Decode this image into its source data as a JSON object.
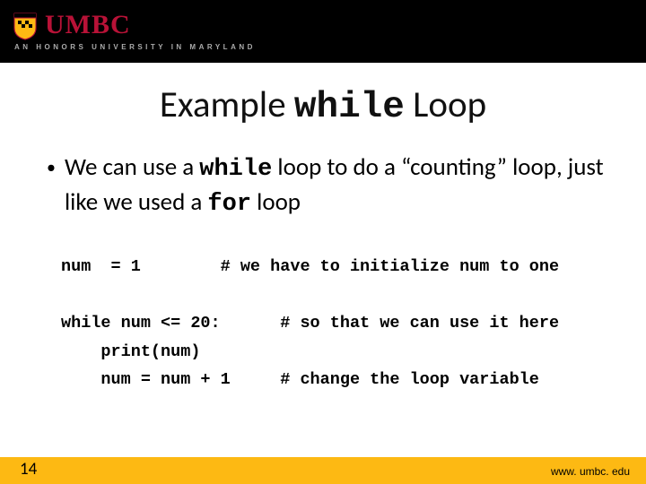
{
  "header": {
    "logo_text": "UMBC",
    "tagline": "AN HONORS UNIVERSITY IN MARYLAND"
  },
  "title": {
    "prefix": "Example ",
    "keyword": "while",
    "suffix": " Loop"
  },
  "bullet": {
    "t1": "We can use a ",
    "kw1": "while",
    "t2": " loop to do a “counting” loop, just like we used a ",
    "kw2": "for",
    "t3": " loop"
  },
  "code": {
    "line1": "num  = 1        # we have to initialize num to one",
    "line2": "",
    "line3": "while num <= 20:      # so that we can use it here",
    "line4": "    print(num)",
    "line5": "    num = num + 1     # change the loop variable"
  },
  "footer": {
    "page": "14",
    "url": "www. umbc. edu"
  }
}
